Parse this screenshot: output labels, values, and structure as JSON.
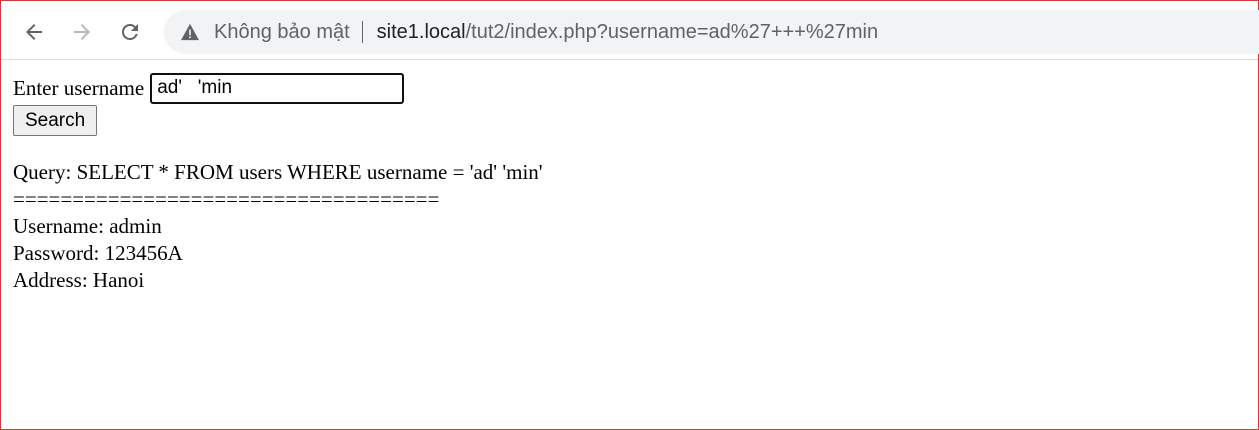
{
  "browser": {
    "security_label": "Không bảo mật",
    "url_host": "site1.local",
    "url_path": "/tut2/index.php?username=ad%27+++%27min"
  },
  "form": {
    "label": "Enter username",
    "input_value": "ad'   'min",
    "button_label": "Search"
  },
  "result": {
    "query": "Query: SELECT * FROM users WHERE username = 'ad' 'min'",
    "separator": "====================================",
    "username": "Username: admin",
    "password": "Password: 123456A",
    "address": "Address: Hanoi"
  }
}
